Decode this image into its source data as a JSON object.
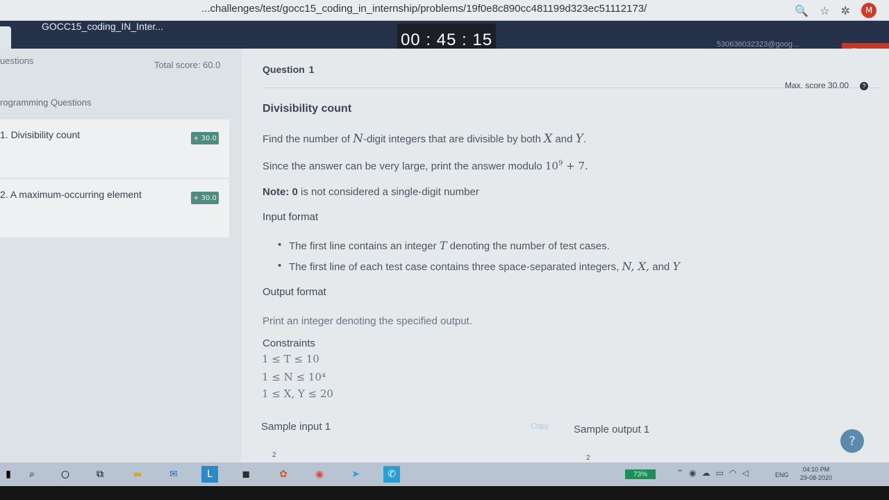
{
  "browser": {
    "url": "...challenges/test/gocc15_coding_in_internship/problems/19f0e8c890cc481199d323ec51112173/",
    "avatar_letter": "M"
  },
  "header": {
    "app_title": "GOCC15_coding_IN_Inter...",
    "timer": "00 : 45 : 15",
    "user_email": "530636032323@goog...",
    "end_test_label": "End test"
  },
  "sidebar": {
    "questions_label": "uestions",
    "total_score": "Total score: 60.0",
    "section_label": "rogramming Questions",
    "items": [
      {
        "label": "1. Divisibility count",
        "score": "+ 30.0"
      },
      {
        "label": "2. A maximum-occurring element",
        "score": "+ 30.0"
      }
    ]
  },
  "question": {
    "heading": "Question",
    "number": "1",
    "max_score": "Max. score 30.00",
    "title": "Divisibility count",
    "line1_a": "Find the number of ",
    "var_N": "N",
    "line1_b": "-digit integers that are divisible by both ",
    "var_X": "X",
    "and": " and ",
    "var_Y": "Y",
    "line1_end": ".",
    "line2": "Since the answer can be very large, print the answer modulo ",
    "modulo": "10",
    "modulo_exp": "9",
    "modulo_tail": " + 7.",
    "note_label": "Note: ",
    "note_zero": "0",
    "note_text": " is not considered a single-digit number",
    "input_format_label": "Input format",
    "bullet1_a": "The first line contains an integer ",
    "var_T": "T",
    "bullet1_b": " denoting the number of test cases.",
    "bullet2_a": "The first line of each test case contains three space-separated integers, ",
    "bullet2_vars": "N, X,",
    "bullet2_and": " and ",
    "bullet2_y": "Y",
    "output_format_label": "Output format",
    "output_text": "Print an integer denoting the specified output.",
    "constraints_label": "Constraints",
    "constraints": [
      "1 ≤ T ≤ 10",
      "1 ≤ N ≤ 10⁴",
      "1 ≤ X, Y ≤ 20"
    ],
    "sample_input_label": "Sample input 1",
    "copy_label": "Copy",
    "sample_output_label": "Sample output 1",
    "small_num": "2"
  },
  "taskbar": {
    "battery": "73%",
    "language": "ENG",
    "time": "04:10 PM",
    "date": "29-08-2020"
  },
  "colors": {
    "header_bg": "#26324a",
    "timer_bg": "#1c1f25",
    "end_test": "#c0392b",
    "badge": "#4f8c7f"
  }
}
